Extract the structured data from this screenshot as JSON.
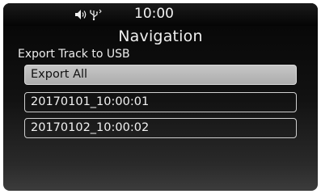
{
  "status_bar": {
    "time": "10:00",
    "icons": [
      "speaker-icon",
      "usb-icon"
    ]
  },
  "screen": {
    "title": "Navigation",
    "subtitle": "Export Track to USB"
  },
  "list": {
    "items": [
      {
        "label": "Export All",
        "selected": true
      },
      {
        "label": "20170101_10:00:01",
        "selected": false
      },
      {
        "label": "20170102_10:00:02",
        "selected": false
      }
    ]
  },
  "colors": {
    "selected_bg": "#b8b8b8",
    "item_border": "#cfcfcf",
    "text": "#f2f2f2"
  }
}
